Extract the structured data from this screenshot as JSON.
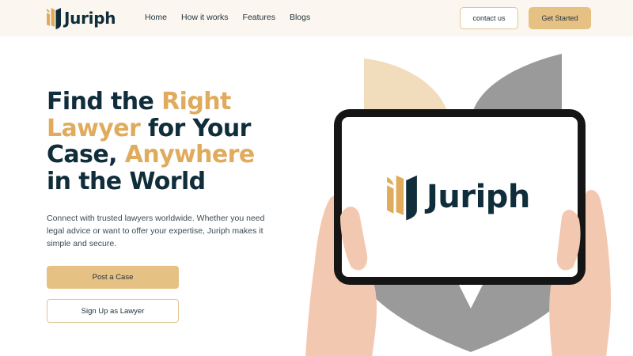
{
  "brand": {
    "name": "Juriph",
    "logo_icon": "juriph-logo-icon"
  },
  "nav": {
    "items": [
      "Home",
      "How it works",
      "Features",
      "Blogs"
    ]
  },
  "header": {
    "contact_label": "contact us",
    "cta_label": "Get Started"
  },
  "hero": {
    "title_part1": "Find the ",
    "title_highlight1": "Right Lawyer",
    "title_part2": " for Your Case, ",
    "title_highlight2": "Anywhere",
    "title_part3": " in the World",
    "description": "Connect with trusted lawyers worldwide. Whether you need legal advice or want to offer your expertise, Juriph makes it simple and secure.",
    "primary_button": "Post a Case",
    "secondary_button": "Sign Up as Lawyer"
  },
  "illustration": {
    "screen_brand": "Juriph"
  },
  "colors": {
    "navy": "#0f2d3a",
    "gold": "#e0ab5c",
    "button_gold": "#e6c184",
    "header_bg": "#fbf7f0",
    "leaf_gray": "#9a9a9a",
    "leaf_cream": "#f1ddbb"
  }
}
